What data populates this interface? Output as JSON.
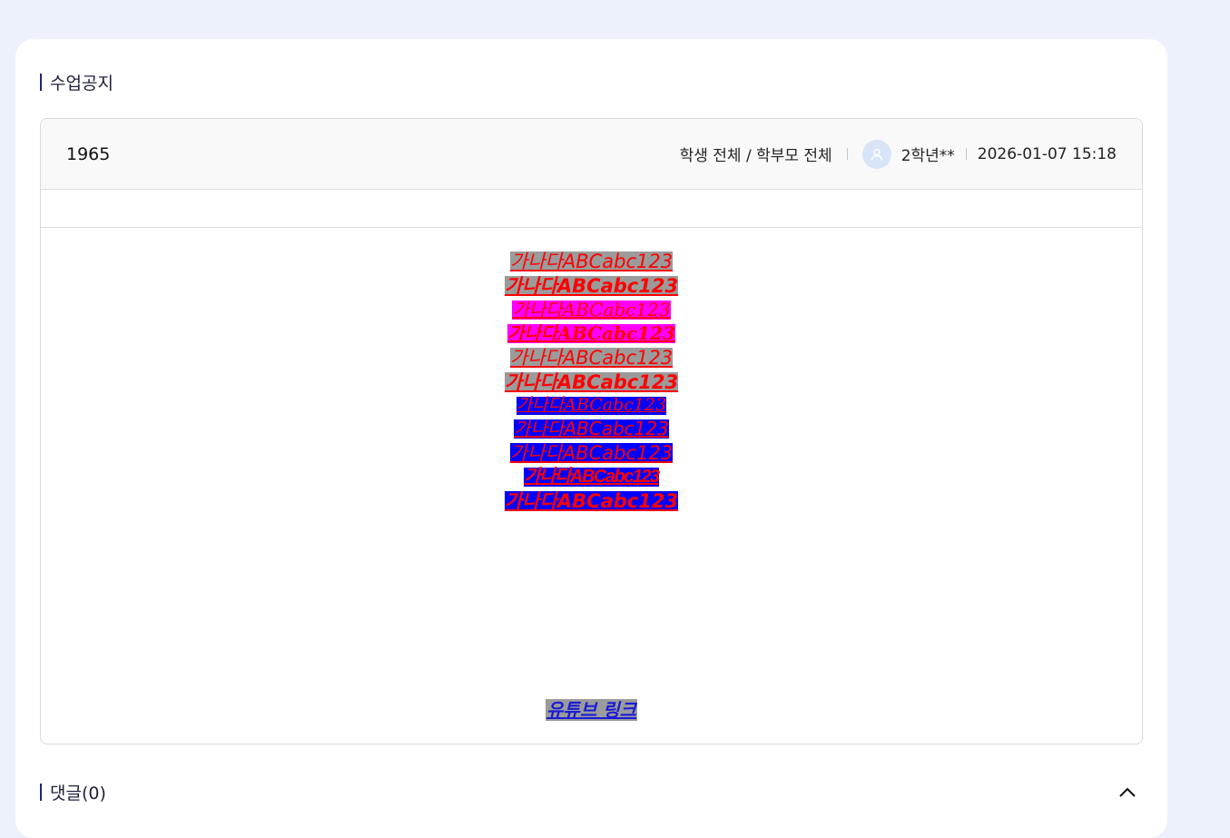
{
  "notice": {
    "section_title": "수업공지",
    "post_title": "1965",
    "audience": "학생 전체 / 학부모 전체",
    "author": "2학년**",
    "datetime": "2026-01-07 15:18"
  },
  "content": {
    "lines": [
      {
        "text": "가나다ABCabc123",
        "bg": "#9b9b9b",
        "family": "sans",
        "weight": "normal",
        "size": 21
      },
      {
        "text": "가나다ABCabc123",
        "bg": "#9b9b9b",
        "family": "sans",
        "weight": "bold",
        "size": 21
      },
      {
        "text": "가나다ABCabc123",
        "bg": "#ff00ff",
        "family": "serif",
        "weight": "normal",
        "size": 20
      },
      {
        "text": "가나다ABCabc123",
        "bg": "#ff00ff",
        "family": "serif",
        "weight": "bold",
        "size": 20
      },
      {
        "text": "가나다ABCabc123",
        "bg": "#9b9b9b",
        "family": "sans",
        "weight": "normal",
        "size": 21
      },
      {
        "text": "가나다ABCabc123",
        "bg": "#9b9b9b",
        "family": "sans",
        "weight": "bold",
        "size": 21
      },
      {
        "text": "가나다ABCabc123",
        "bg": "#0000ff",
        "family": "serif",
        "weight": "normal",
        "size": 19
      },
      {
        "text": "가나다ABCabc123",
        "bg": "#0000ff",
        "family": "sans",
        "weight": "normal",
        "size": 20
      },
      {
        "text": "가나다ABCabc123",
        "bg": "#0000ff",
        "family": "sans",
        "weight": "normal",
        "size": 21
      },
      {
        "text": "가나다ABCabc123",
        "bg": "#0000ff",
        "family": "condensed",
        "weight": "bold",
        "size": 20
      },
      {
        "text": "가나다ABCabc123",
        "bg": "#0000ff",
        "family": "sans",
        "weight": "bold",
        "size": 21
      }
    ],
    "youtube_link": "유튜브 링크"
  },
  "comments": {
    "section_title": "댓글(0)"
  },
  "icons": {
    "avatar": "user-avatar-icon",
    "collapse": "chevron-up-icon"
  }
}
